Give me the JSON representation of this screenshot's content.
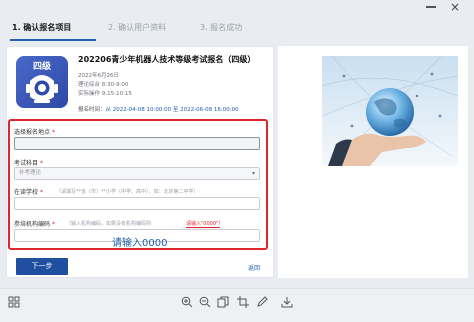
{
  "window": {
    "close_glyph": "×"
  },
  "steps": [
    {
      "label": "1. 确认报名项目",
      "active": true
    },
    {
      "label": "2. 确认用户资料",
      "active": false
    },
    {
      "label": "3. 报名成功",
      "active": false
    }
  ],
  "exam": {
    "badge_level": "四级",
    "title": "202206青少年机器人技术等级考试报名（四级）",
    "date": "2022年6月26日",
    "theory": "理论综合 8:30-9:00",
    "practice": "实际操作 9:15-10:15",
    "deadline_label": "报名时间：",
    "deadline_value": "从 2022-04-08 10:00:00 至 2022-06-08 16:00:00"
  },
  "form": {
    "location": {
      "label": "选择报名地点",
      "required": "*",
      "value": ""
    },
    "subject": {
      "label": "考试科目",
      "required": "*",
      "value": "补考理论"
    },
    "school": {
      "label": "在读学校",
      "required": "*",
      "placeholder": "（请填写**省（市）**小学（中学、高中），如：北京第二中学）"
    },
    "org": {
      "label": "参培机构编码",
      "required": "*",
      "hint": "（输入机构编码，如果没有机构编码则",
      "hint_red": "请输入\"0000\"）",
      "value": ""
    },
    "annotation": "请输入0000",
    "next_button": "下一步",
    "back_link": "返回"
  },
  "toolbar": {
    "icons": [
      "grid-icon",
      "zoom-in-icon",
      "zoom-out-icon",
      "copy-icon",
      "crop-icon",
      "edit-icon",
      "download-icon"
    ]
  }
}
